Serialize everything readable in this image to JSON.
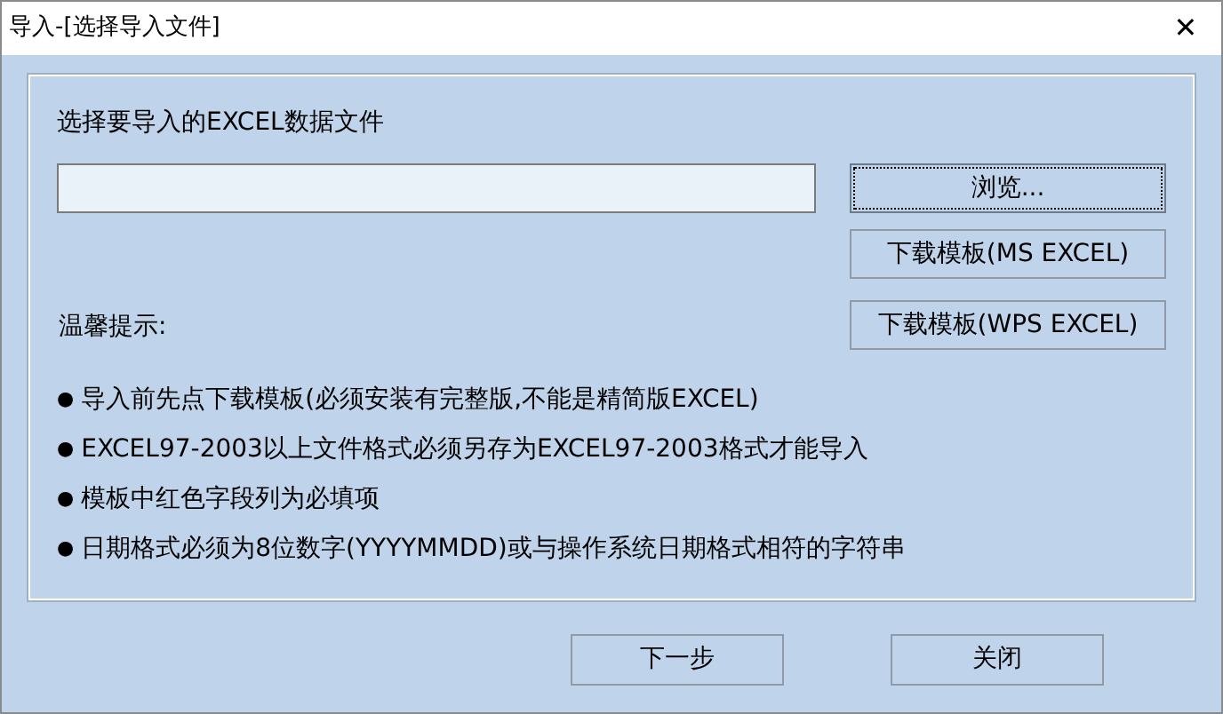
{
  "window": {
    "title": "导入-[选择导入文件]",
    "close": "✕"
  },
  "file_label": "选择要导入的EXCEL数据文件",
  "buttons": [
    {
      "label": "浏览...",
      "focused": true
    },
    {
      "label": "下载模板(MS EXCEL)",
      "focused": false
    },
    {
      "label": "下载模板(WPS EXCEL)",
      "focused": false
    }
  ],
  "tips_title": "温馨提示:",
  "tips": [
    {
      "bullet": "●",
      "text": "导入前先点下载模板(必须安装有完整版,不能是精简版EXCEL)"
    },
    {
      "bullet": "●",
      "text": "EXCEL97-2003以上文件格式必须另存为EXCEL97-2003格式才能导入"
    },
    {
      "bullet": "●",
      "text": "模板中红色字段列为必填项"
    },
    {
      "bullet": "●",
      "text": "日期格式必须为8位数字(YYYYMMDD)或与操作系统日期格式相符的字符串"
    }
  ],
  "footer_buttons": [
    "下一步",
    "关闭"
  ]
}
